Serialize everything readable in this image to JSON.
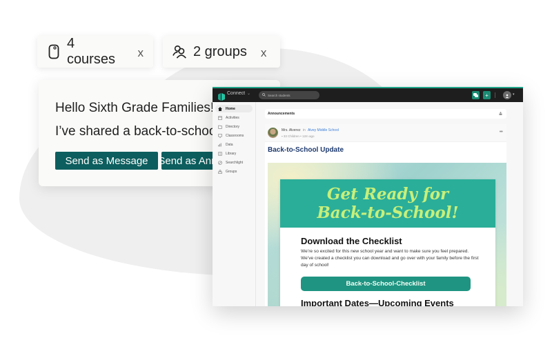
{
  "chips": [
    {
      "icon": "device-icon",
      "label": "4 courses",
      "remove": "x"
    },
    {
      "icon": "users-icon",
      "label": "2 groups",
      "remove": "x"
    }
  ],
  "message_card": {
    "line1": "Hello Sixth Grade Families!",
    "line2": "I’ve shared a back-to-school update",
    "buttons": [
      "Send as Message",
      "Send as Announcement"
    ]
  },
  "app": {
    "brand": "Connect",
    "search_placeholder": "Search students",
    "colors": {
      "accent": "#1fa489",
      "topbar": "#1e1e1e",
      "button": "#0d5e5e"
    },
    "sidebar": [
      {
        "label": "Home",
        "icon": "home-icon",
        "active": true
      },
      {
        "label": "Activities",
        "icon": "calendar-icon"
      },
      {
        "label": "Directory",
        "icon": "folder-icon"
      },
      {
        "label": "Classrooms",
        "icon": "classroom-icon"
      },
      {
        "label": "Data",
        "icon": "chart-icon"
      },
      {
        "label": "Library",
        "icon": "book-icon"
      },
      {
        "label": "Searchlight",
        "icon": "searchlight-icon"
      },
      {
        "label": "Groups",
        "icon": "groups-icon"
      }
    ],
    "announcements_label": "Announcements",
    "post": {
      "author": "Mrs. Alverez",
      "in": "in",
      "school": "Alvey Middle School",
      "meta": "33 Children • 12m ago",
      "more": "•••",
      "title": "Back-to-School Update",
      "banner_title_line1": "Get Ready for",
      "banner_title_line2": "Back-to-School!",
      "heading": "Download the Checklist",
      "body": "We’re so excited for this new school year and want to make sure you feel prepared. We’ve created a checklist you can download and go over with your family before the first day of school!",
      "button": "Back-to-School-Checklist",
      "heading2": "Important Dates—Upcoming Events"
    }
  }
}
